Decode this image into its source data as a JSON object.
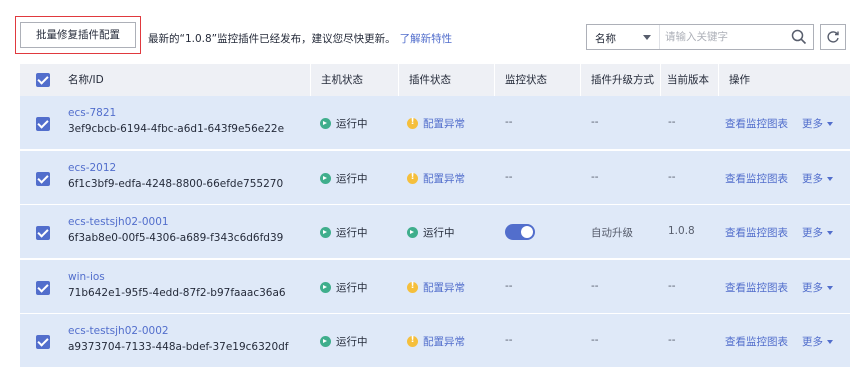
{
  "toolbar": {
    "batch_button": "批量修复插件配置",
    "notice_text": "最新的“1.0.8”监控插件已经发布，建议您尽快更新。",
    "notice_link": "了解新特性",
    "search_field": "名称",
    "search_placeholder": "请输入关键字"
  },
  "colors": {
    "accent": "#526ecc",
    "row_bg": "#dfe9f8",
    "ok": "#3fae8c",
    "warn": "#f5bf3c",
    "highlight_border": "#e0393e"
  },
  "icons": {
    "search": "search-icon",
    "refresh": "refresh-icon",
    "ok": "running-status-icon",
    "warn": "warning-icon"
  },
  "table": {
    "columns": [
      "名称/ID",
      "主机状态",
      "插件状态",
      "监控状态",
      "插件升级方式",
      "当前版本",
      "操作"
    ],
    "rows": [
      {
        "name": "ecs-7821",
        "id": "3ef9cbcb-6194-4fbc-a6d1-643f9e56e22e",
        "host_status": "运行中",
        "plugin_status": "配置异常",
        "plugin_ok": false,
        "monitor": "--",
        "monitor_on": false,
        "upgrade": "--",
        "version": "--",
        "op_view": "查看监控图表",
        "op_more": "更多",
        "checked": true
      },
      {
        "name": "ecs-2012",
        "id": "6f1c3bf9-edfa-4248-8800-66efde755270",
        "host_status": "运行中",
        "plugin_status": "配置异常",
        "plugin_ok": false,
        "monitor": "--",
        "monitor_on": false,
        "upgrade": "--",
        "version": "--",
        "op_view": "查看监控图表",
        "op_more": "更多",
        "checked": true
      },
      {
        "name": "ecs-testsjh02-0001",
        "id": "6f3ab8e0-00f5-4306-a689-f343c6d6fd39",
        "host_status": "运行中",
        "plugin_status": "运行中",
        "plugin_ok": true,
        "monitor": "",
        "monitor_on": true,
        "upgrade": "自动升级",
        "version": "1.0.8",
        "op_view": "查看监控图表",
        "op_more": "更多",
        "checked": true
      },
      {
        "name": "win-ios",
        "id": "71b642e1-95f5-4edd-87f2-b97faaac36a6",
        "host_status": "运行中",
        "plugin_status": "配置异常",
        "plugin_ok": false,
        "monitor": "--",
        "monitor_on": false,
        "upgrade": "--",
        "version": "--",
        "op_view": "查看监控图表",
        "op_more": "更多",
        "checked": true
      },
      {
        "name": "ecs-testsjh02-0002",
        "id": "a9373704-7133-448a-bdef-37e19c6320df",
        "host_status": "运行中",
        "plugin_status": "配置异常",
        "plugin_ok": false,
        "monitor": "--",
        "monitor_on": false,
        "upgrade": "--",
        "version": "--",
        "op_view": "查看监控图表",
        "op_more": "更多",
        "checked": true
      }
    ]
  }
}
